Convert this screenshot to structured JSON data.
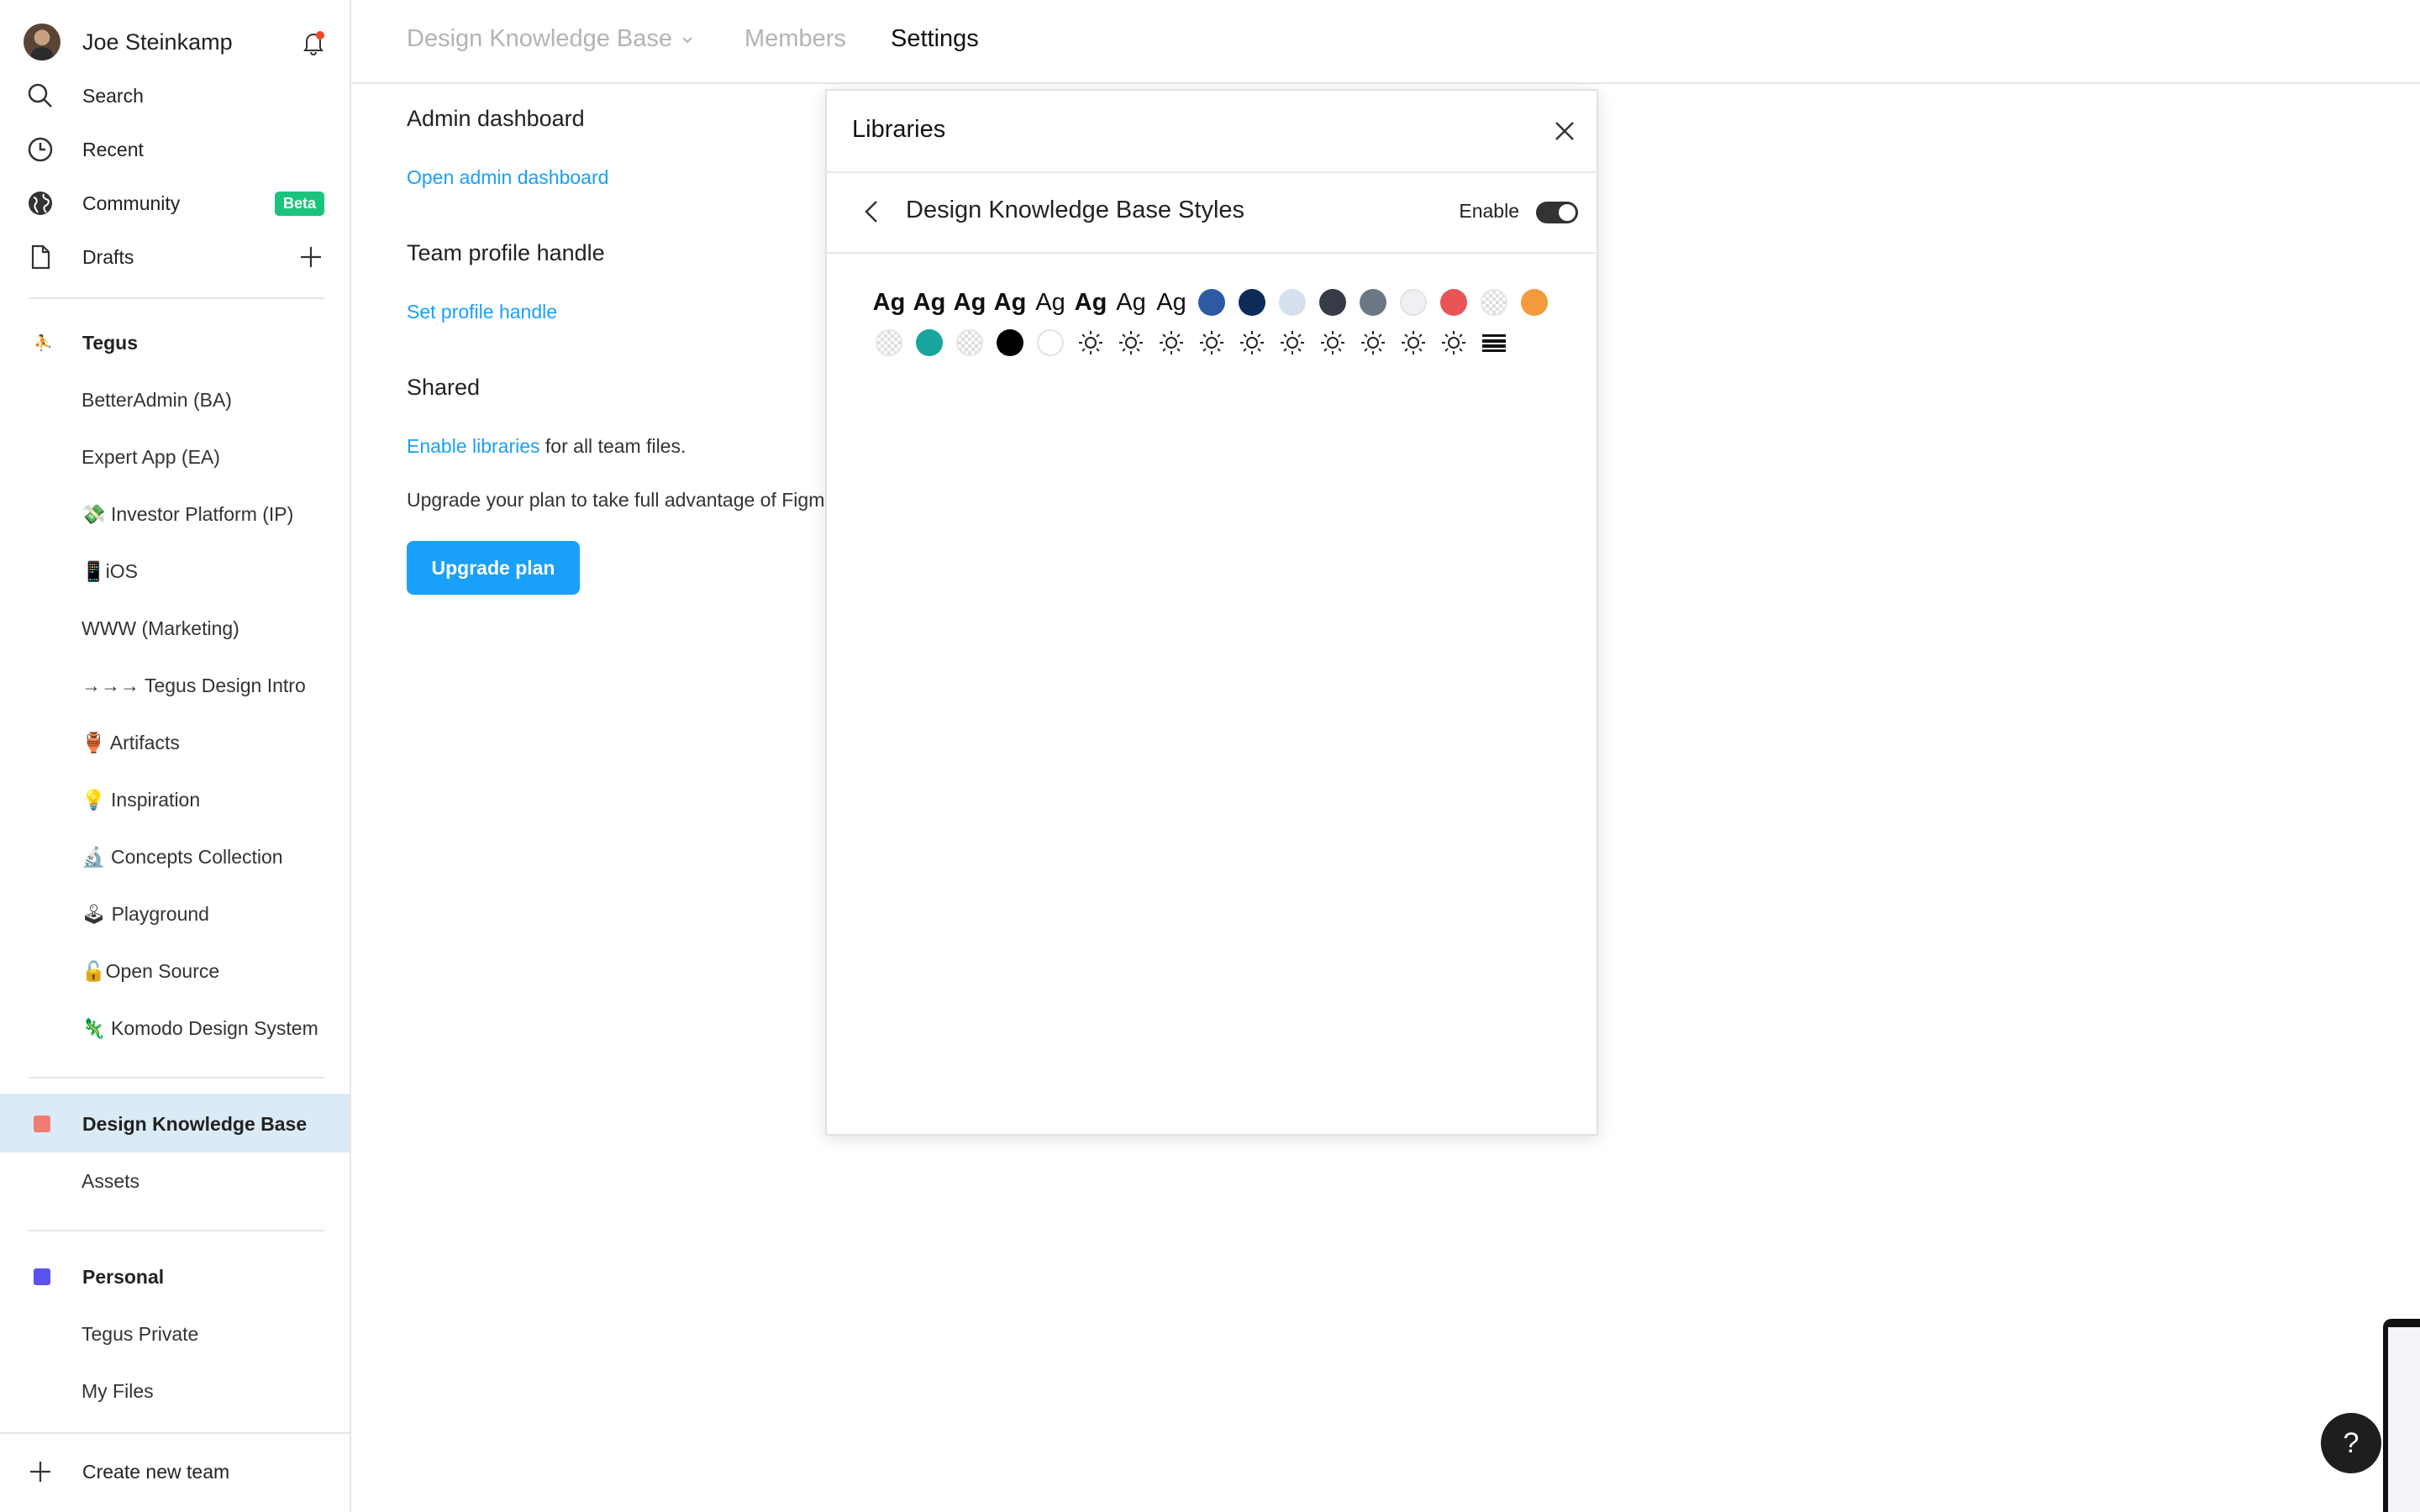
{
  "user": {
    "name": "Joe Steinkamp"
  },
  "nav": {
    "search": "Search",
    "recent": "Recent",
    "community": "Community",
    "community_badge": "Beta",
    "drafts": "Drafts"
  },
  "teams": [
    {
      "name": "Tegus",
      "projects": [
        "BetterAdmin (BA)",
        "Expert App (EA)",
        "💸 Investor Platform (IP)",
        "📱iOS",
        "WWW (Marketing)",
        "→→→ Tegus Design Intro",
        "🏺 Artifacts",
        "💡 Inspiration",
        "🔬 Concepts Collection",
        "🕹 Playground",
        "🔓Open Source",
        "🦎 Komodo Design System"
      ]
    },
    {
      "name": "Design Knowledge Base",
      "color": "#f07d73",
      "projects": [
        "Assets"
      ]
    },
    {
      "name": "Personal",
      "color": "#5b53f0",
      "projects": [
        "Tegus Private",
        "My Files"
      ]
    }
  ],
  "create_team": "Create new team",
  "topnav": {
    "team": "Design Knowledge Base",
    "members": "Members",
    "settings": "Settings"
  },
  "settings": {
    "admin_heading": "Admin dashboard",
    "admin_link": "Open admin dashboard",
    "profile_heading": "Team profile handle",
    "profile_link": "Set profile handle",
    "shared_heading": "Shared",
    "enable_link": "Enable libraries",
    "enable_rest": " for all team files.",
    "upgrade_text": "Upgrade your plan to take full advantage of Figm",
    "upgrade_button": "Upgrade plan"
  },
  "modal": {
    "title": "Libraries",
    "library_name": "Design Knowledge Base Styles",
    "enable_label": "Enable",
    "enabled": true,
    "text_styles": [
      {
        "label": "Ag",
        "weight": "800"
      },
      {
        "label": "Ag",
        "weight": "700"
      },
      {
        "label": "Ag",
        "weight": "700"
      },
      {
        "label": "Ag",
        "weight": "700"
      },
      {
        "label": "Ag",
        "weight": "400"
      },
      {
        "label": "Ag",
        "weight": "800"
      },
      {
        "label": "Ag",
        "weight": "400"
      },
      {
        "label": "Ag",
        "weight": "400"
      }
    ],
    "colors_row1": [
      "#2d5ba3",
      "#0d2b57",
      "#d5dfed",
      "#363b45",
      "#6b7785",
      "#eef0f3",
      "#e95456",
      "checker",
      "#f39a3c"
    ],
    "colors_row2": [
      "checker",
      "#17a59e",
      "checker",
      "#000000",
      "#ffffff"
    ],
    "effect_count": 10,
    "grid_style": "grid"
  },
  "help_label": "?"
}
